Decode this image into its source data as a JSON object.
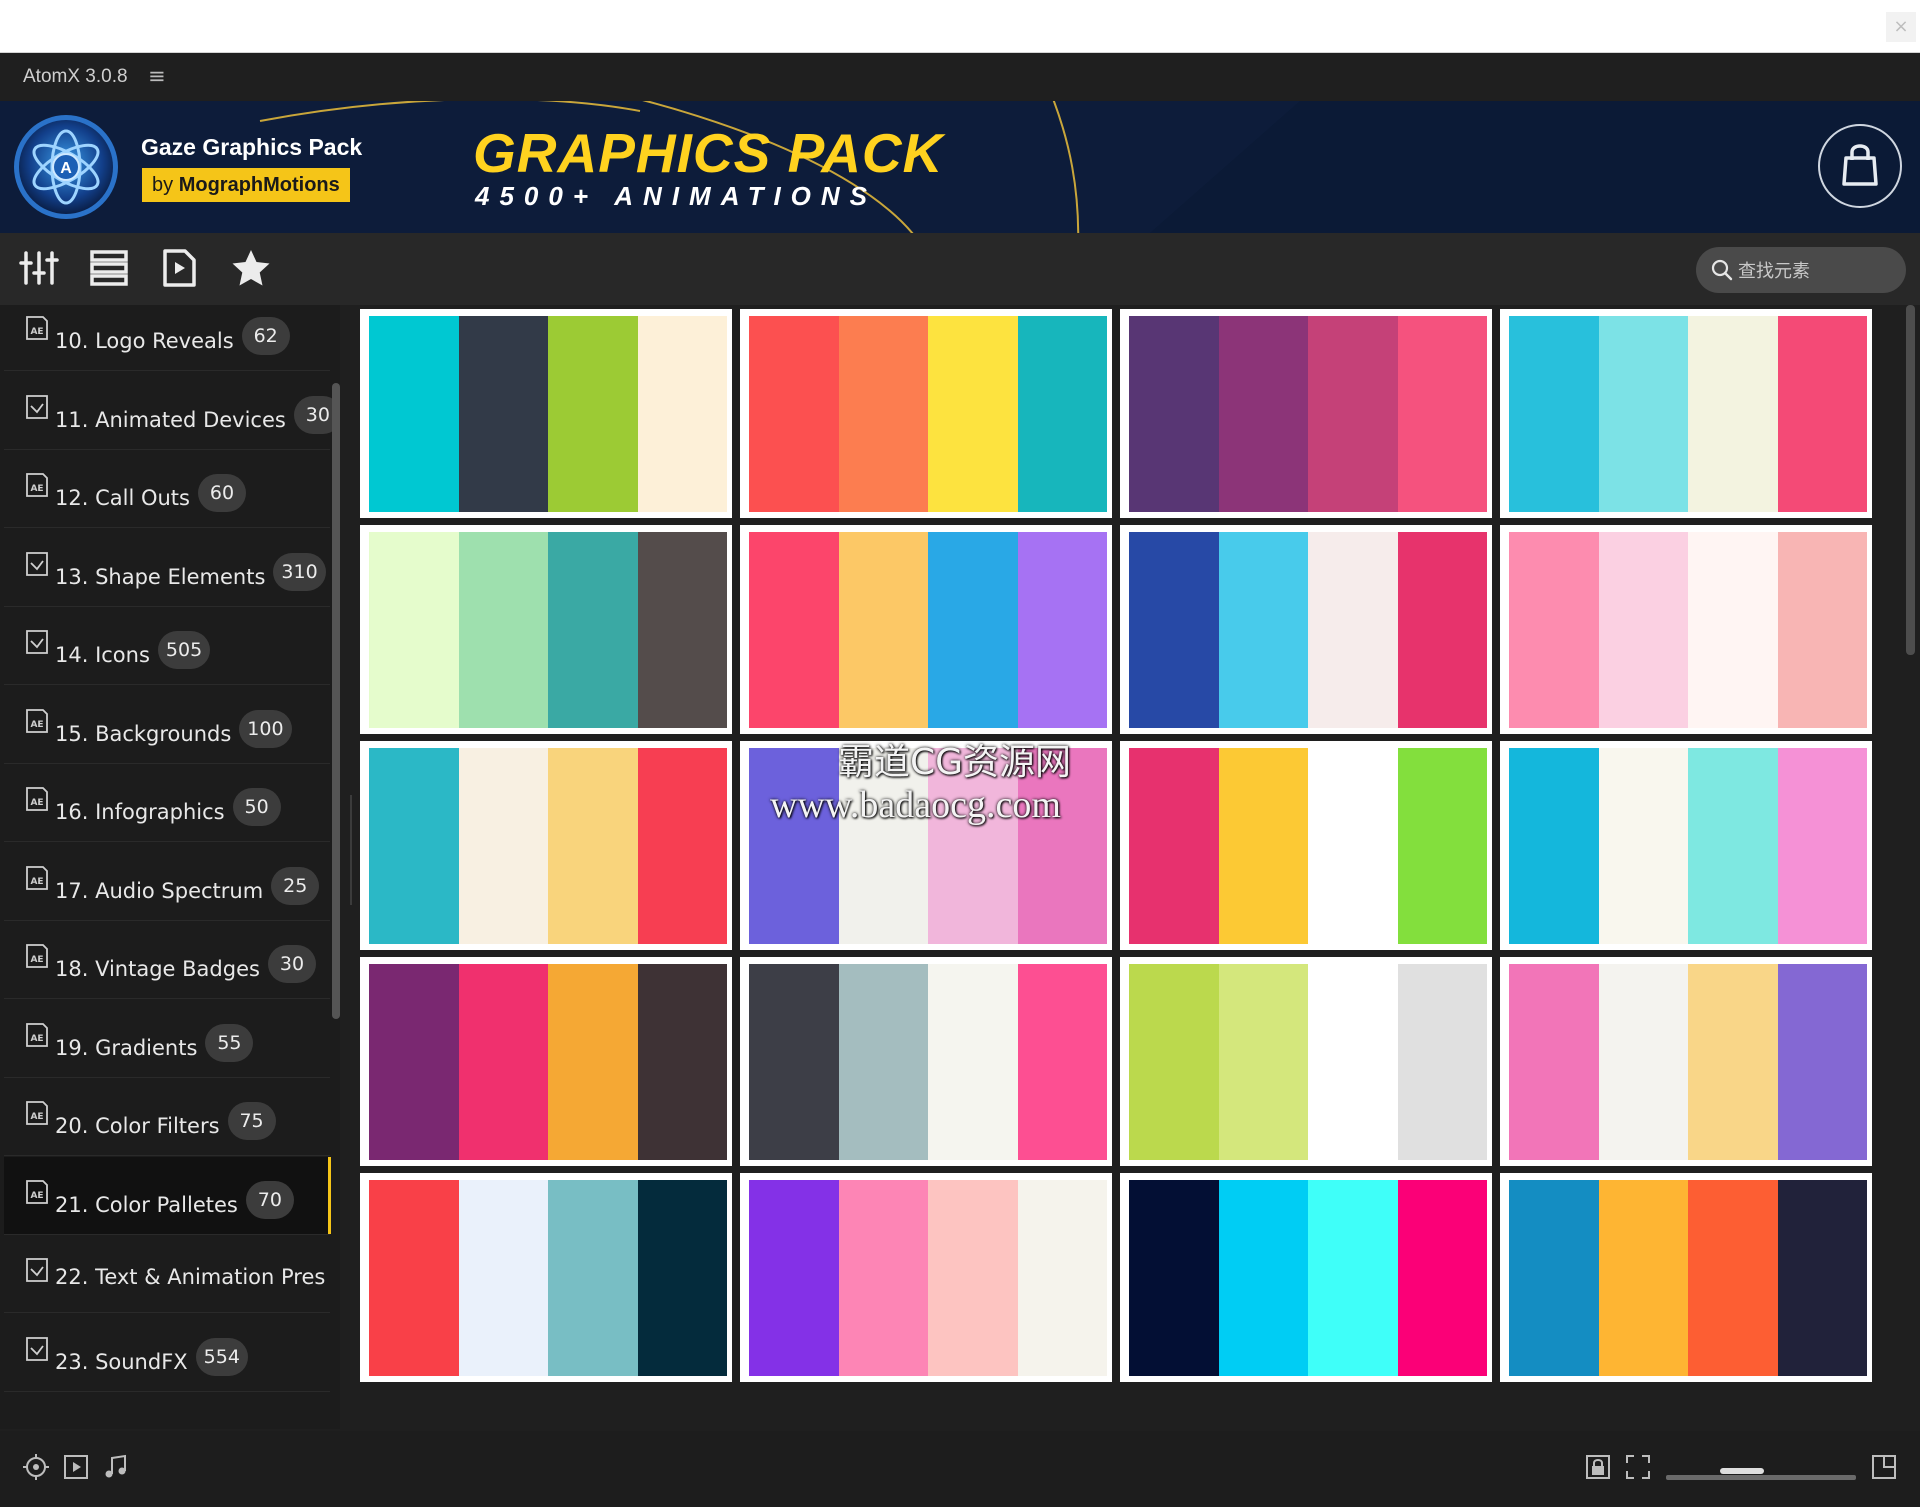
{
  "window": {
    "close_glyph": "×"
  },
  "app": {
    "title": "AtomX 3.0.8",
    "menu_icon": "hamburger-icon"
  },
  "banner": {
    "pack_name": "Gaze Graphics Pack",
    "by_prefix": "by",
    "by_author": "MographMotions",
    "headline": "GRAPHICS PACK",
    "subheadline": "4500+ ANIMATIONS",
    "cart_icon": "shopping-bag-icon"
  },
  "toolbar": {
    "tools": [
      "sliders-icon",
      "list-view-icon",
      "media-file-icon",
      "favorites-star-icon"
    ],
    "search_placeholder": "查找元素"
  },
  "sidebar": {
    "items": [
      {
        "label": "10. Logo Reveals",
        "count": "62",
        "icon": "ae-file-icon"
      },
      {
        "label": "11. Animated Devices",
        "count": "30",
        "icon": "preset-icon"
      },
      {
        "label": "12. Call Outs",
        "count": "60",
        "icon": "ae-file-icon"
      },
      {
        "label": "13. Shape Elements",
        "count": "310",
        "icon": "preset-icon"
      },
      {
        "label": "14. Icons",
        "count": "505",
        "icon": "preset-icon"
      },
      {
        "label": "15. Backgrounds",
        "count": "100",
        "icon": "ae-file-icon"
      },
      {
        "label": "16. Infographics",
        "count": "50",
        "icon": "ae-file-icon"
      },
      {
        "label": "17. Audio Spectrum",
        "count": "25",
        "icon": "ae-file-icon"
      },
      {
        "label": "18. Vintage Badges",
        "count": "30",
        "icon": "ae-file-icon"
      },
      {
        "label": "19. Gradients",
        "count": "55",
        "icon": "ae-file-icon"
      },
      {
        "label": "20. Color Filters",
        "count": "75",
        "icon": "ae-file-icon"
      },
      {
        "label": "21. Color Palletes",
        "count": "70",
        "icon": "ae-file-icon",
        "active": true
      },
      {
        "label": "22. Text & Animation Pres",
        "count": "",
        "icon": "preset-icon"
      },
      {
        "label": "23. SoundFX",
        "count": "554",
        "icon": "preset-icon"
      }
    ]
  },
  "palettes": [
    [
      "#00c8d2",
      "#323a48",
      "#9ccb34",
      "#fdf0d8"
    ],
    [
      "#fc5050",
      "#fc7d50",
      "#fde33f",
      "#17b6bc"
    ],
    [
      "#583674",
      "#8c3478",
      "#c54178",
      "#f5527e"
    ],
    [
      "#28c0dc",
      "#7ce2e6",
      "#f3f3e0",
      "#f44a76"
    ],
    [
      "#e5fccc",
      "#9ee0ae",
      "#3aa9a4",
      "#544c4b"
    ],
    [
      "#fc456b",
      "#fcc866",
      "#29a8e6",
      "#a672f3"
    ],
    [
      "#2749a6",
      "#48cbeb",
      "#f6eceb",
      "#e7336c"
    ],
    [
      "#fd8caf",
      "#fbd0e2",
      "#fff5f3",
      "#f8b5b4"
    ],
    [
      "#2bb8c6",
      "#f8f0e2",
      "#f9d47c",
      "#f73e52"
    ],
    [
      "#6c61dc",
      "#f1f1ec",
      "#f1b6db",
      "#ea76be"
    ],
    [
      "#e7316e",
      "#fcc934",
      "#ffffff",
      "#83df3d"
    ],
    [
      "#14b7dc",
      "#f9f7ee",
      "#7ee8e1",
      "#f591d6"
    ],
    [
      "#7a2871",
      "#f0306e",
      "#f5a834",
      "#3e3235"
    ],
    [
      "#3d3e47",
      "#a4bdbf",
      "#f5f5ef",
      "#fd4f92"
    ],
    [
      "#bbd94d",
      "#d4e77c",
      "#ffffff",
      "#e0e0e0"
    ],
    [
      "#f275b8",
      "#f4f3ef",
      "#f9d688",
      "#8468d3"
    ],
    [
      "#f94048",
      "#eaf1fb",
      "#78bec4",
      "#042b3c"
    ],
    [
      "#8431e7",
      "#fd85b5",
      "#fdc4c1",
      "#f5f3ec"
    ],
    [
      "#030f34",
      "#00cdf4",
      "#3ffff9",
      "#fb0077"
    ],
    [
      "#148dc2",
      "#feb533",
      "#fd5e33",
      "#21223a"
    ]
  ],
  "statusbar": {
    "left_icons": [
      "target-icon",
      "video-play-icon",
      "music-note-icon"
    ],
    "right_icons": [
      "lock-icon",
      "fit-frame-icon",
      "expand-icon"
    ],
    "zoom_fraction": 0.4
  },
  "watermark": {
    "line1": "霸道CG资源网",
    "line2": "www.badaocg.com"
  }
}
